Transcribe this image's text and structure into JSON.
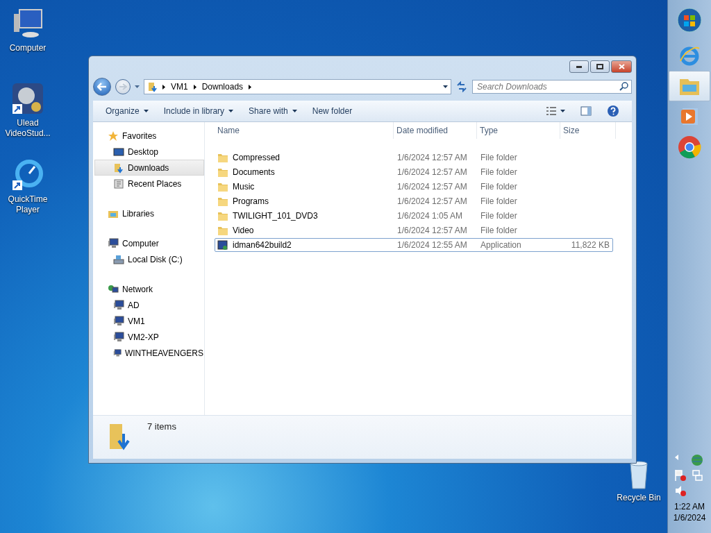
{
  "desktop_icons": [
    {
      "label": "Computer",
      "kind": "computer"
    },
    {
      "label": "Ulead VideoStud...",
      "kind": "video_app"
    },
    {
      "label": "QuickTime Player",
      "kind": "quicktime"
    }
  ],
  "recycle_bin": {
    "label": "Recycle Bin"
  },
  "window": {
    "breadcrumb": [
      "VM1",
      "Downloads"
    ],
    "search": {
      "placeholder": "Search Downloads"
    },
    "toolbar": [
      {
        "label": "Organize",
        "dropdown": true
      },
      {
        "label": "Include in library",
        "dropdown": true
      },
      {
        "label": "Share with",
        "dropdown": true
      },
      {
        "label": "New folder",
        "dropdown": false
      }
    ],
    "nav": [
      {
        "label": "Favorites",
        "kind": "star",
        "selected": false,
        "children": [
          {
            "label": "Desktop",
            "kind": "desktop",
            "selected": false
          },
          {
            "label": "Downloads",
            "kind": "downloads",
            "selected": true
          },
          {
            "label": "Recent Places",
            "kind": "recent",
            "selected": false
          }
        ]
      },
      {
        "label": "Libraries",
        "kind": "library",
        "selected": false
      },
      {
        "label": "Computer",
        "kind": "computer",
        "selected": false,
        "children": [
          {
            "label": "Local Disk (C:)",
            "kind": "disk",
            "selected": false
          }
        ]
      },
      {
        "label": "Network",
        "kind": "network",
        "selected": false,
        "children": [
          {
            "label": "AD",
            "kind": "computer",
            "selected": false
          },
          {
            "label": "VM1",
            "kind": "computer",
            "selected": false
          },
          {
            "label": "VM2-XP",
            "kind": "computer",
            "selected": false
          },
          {
            "label": "WINTHEAVENGERS",
            "kind": "computer",
            "selected": false
          }
        ]
      }
    ],
    "columns": [
      "Name",
      "Date modified",
      "Type",
      "Size"
    ],
    "rows": [
      {
        "name": "Compressed",
        "date": "1/6/2024 12:57 AM",
        "type": "File folder",
        "size": "",
        "kind": "folder",
        "selected": false
      },
      {
        "name": "Documents",
        "date": "1/6/2024 12:57 AM",
        "type": "File folder",
        "size": "",
        "kind": "folder",
        "selected": false
      },
      {
        "name": "Music",
        "date": "1/6/2024 12:57 AM",
        "type": "File folder",
        "size": "",
        "kind": "folder",
        "selected": false
      },
      {
        "name": "Programs",
        "date": "1/6/2024 12:57 AM",
        "type": "File folder",
        "size": "",
        "kind": "folder",
        "selected": false
      },
      {
        "name": "TWILIGHT_101_DVD3",
        "date": "1/6/2024 1:05 AM",
        "type": "File folder",
        "size": "",
        "kind": "folder",
        "selected": false
      },
      {
        "name": "Video",
        "date": "1/6/2024 12:57 AM",
        "type": "File folder",
        "size": "",
        "kind": "folder",
        "selected": false
      },
      {
        "name": "idman642build2",
        "date": "1/6/2024 12:55 AM",
        "type": "Application",
        "size": "11,822 KB",
        "kind": "application",
        "selected": true
      }
    ],
    "status": "7 items"
  },
  "taskbar": {
    "pinned": [
      {
        "kind": "ie",
        "active": false
      },
      {
        "kind": "explorer",
        "active": true
      },
      {
        "kind": "media",
        "active": false
      },
      {
        "kind": "chrome",
        "active": false
      }
    ],
    "time": "1:22 AM",
    "date": "1/6/2024"
  }
}
